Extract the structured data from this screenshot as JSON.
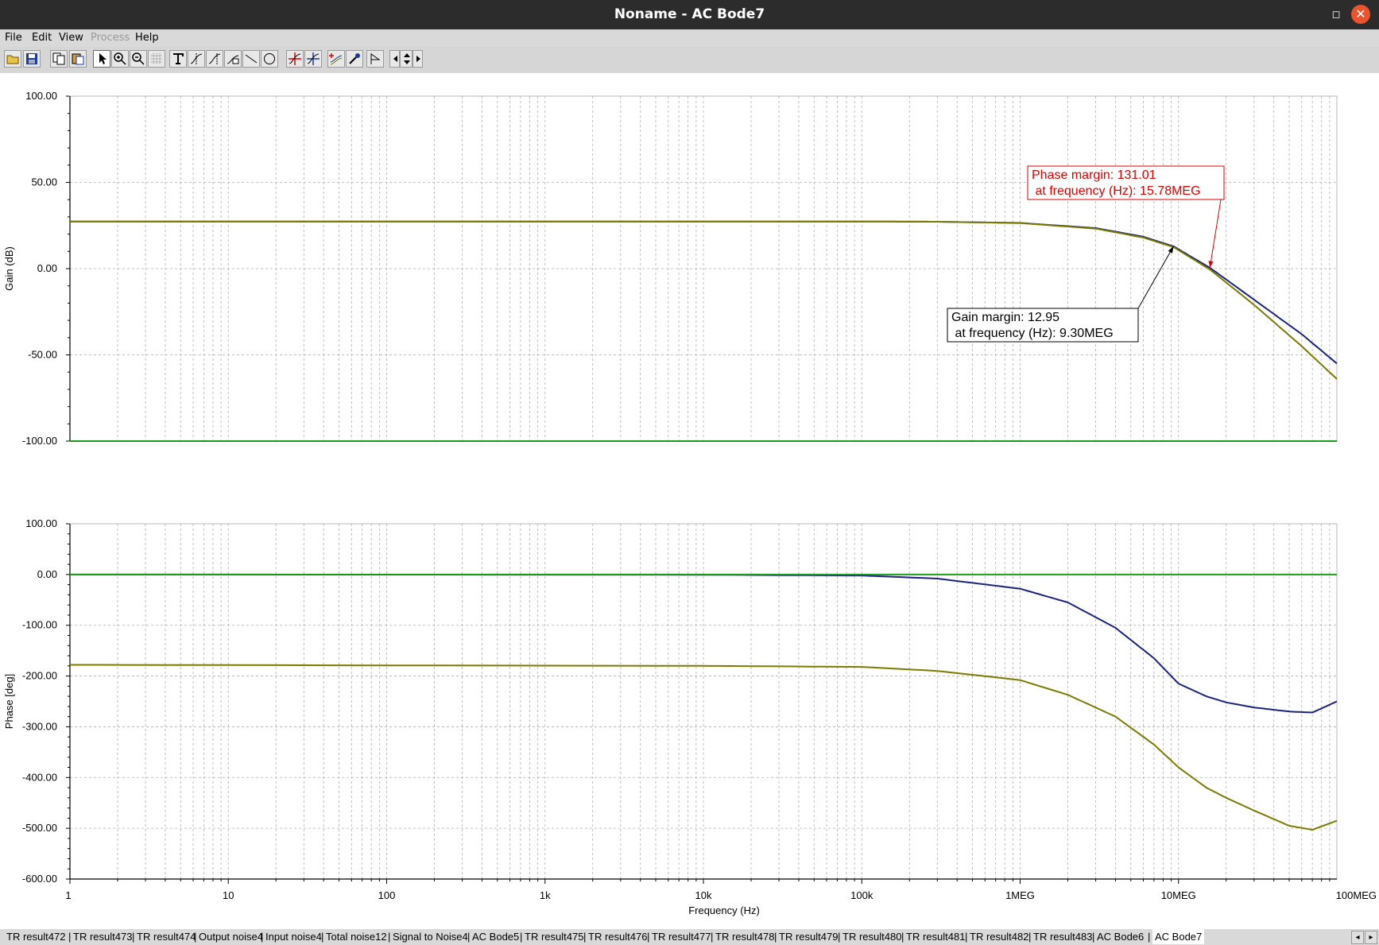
{
  "window": {
    "title": "Noname - AC Bode7",
    "maximize_glyph": "◻",
    "close_glyph": "✕"
  },
  "menu": [
    {
      "label": "File",
      "enabled": true
    },
    {
      "label": "Edit",
      "enabled": true
    },
    {
      "label": "View",
      "enabled": true
    },
    {
      "label": "Process",
      "enabled": false
    },
    {
      "label": "Help",
      "enabled": true
    }
  ],
  "toolbar": [
    {
      "icon": "open-folder-icon"
    },
    {
      "icon": "save-icon"
    },
    {
      "icon": "copy-icon"
    },
    {
      "icon": "paste-icon"
    },
    {
      "icon": "select-arrow-icon",
      "pressed": true
    },
    {
      "icon": "zoom-in-icon"
    },
    {
      "icon": "zoom-out-icon"
    },
    {
      "icon": "grid-icon"
    },
    {
      "icon": "text-tool-icon"
    },
    {
      "icon": "cursor-a-icon"
    },
    {
      "icon": "cursor-b-icon"
    },
    {
      "icon": "curve-label-icon"
    },
    {
      "icon": "line-tool-icon"
    },
    {
      "icon": "circle-tool-icon"
    },
    {
      "icon": "cursor-a-red-icon"
    },
    {
      "icon": "cursor-b-blue-icon"
    },
    {
      "icon": "add-curve-icon"
    },
    {
      "icon": "probe-icon"
    },
    {
      "icon": "arrow-tool-icon"
    },
    {
      "icon": "scroll-left-icon"
    },
    {
      "icon": "scroll-up-down-icon"
    },
    {
      "icon": "scroll-right-icon"
    }
  ],
  "colors": {
    "blue": "#1a237e",
    "olive": "#7b7b00",
    "green": "#1e9a1e",
    "red": "#e00000",
    "grid": "#b0b0b0"
  },
  "chart_data": [
    {
      "type": "line",
      "ylabel": "Gain (dB)",
      "xlabel": "",
      "x_scale": "log",
      "xlim": [
        1,
        100000000
      ],
      "ylim": [
        -100,
        100
      ],
      "y_ticks": [
        "100.00",
        "50.00",
        "0.00",
        "-50.00",
        "-100.00"
      ],
      "grid": true,
      "series": [
        {
          "color": "blue",
          "x": [
            1,
            1000,
            100000,
            300000,
            1000000,
            3000000,
            6000000,
            9300000,
            15780000,
            30000000,
            60000000,
            100000000
          ],
          "y": [
            27.3,
            27.3,
            27.3,
            27.2,
            26.5,
            23.5,
            18.5,
            12.95,
            0.5,
            -18,
            -38,
            -55
          ]
        },
        {
          "color": "olive",
          "x": [
            1,
            1000,
            100000,
            300000,
            1000000,
            3000000,
            6000000,
            9300000,
            15780000,
            30000000,
            60000000,
            100000000
          ],
          "y": [
            27.3,
            27.3,
            27.3,
            27.2,
            26.4,
            23.2,
            18,
            12.5,
            -0.5,
            -21,
            -45,
            -64
          ]
        },
        {
          "color": "green",
          "x": [
            1,
            100000000
          ],
          "y": [
            -100,
            -100
          ]
        }
      ],
      "annotations": [
        {
          "id": "phase-margin",
          "color": "red",
          "lines": [
            "Phase margin: 131.01",
            " at frequency (Hz): 15.78MEG"
          ],
          "point": [
            15780000,
            0.5
          ]
        },
        {
          "id": "gain-margin",
          "color": "black",
          "lines": [
            "Gain margin: 12.95",
            " at frequency (Hz): 9.30MEG"
          ],
          "point": [
            9300000,
            12.95
          ]
        }
      ]
    },
    {
      "type": "line",
      "ylabel": "Phase [deg]",
      "xlabel": "Frequency (Hz)",
      "x_scale": "log",
      "xlim": [
        1,
        100000000
      ],
      "ylim": [
        -600,
        100
      ],
      "y_ticks": [
        "100.00",
        "0.00",
        "-100.00",
        "-200.00",
        "-300.00",
        "-400.00",
        "-500.00",
        "-600.00"
      ],
      "x_ticks": [
        "1",
        "10",
        "100",
        "1k",
        "10k",
        "100k",
        "1MEG",
        "10MEG",
        "100MEG"
      ],
      "grid": true,
      "series": [
        {
          "color": "blue",
          "x": [
            1,
            10000,
            100000,
            300000,
            1000000,
            2000000,
            4000000,
            7000000,
            10000000,
            15000000,
            20000000,
            30000000,
            50000000,
            70000000,
            100000000
          ],
          "y": [
            0,
            -0.5,
            -2,
            -8,
            -28,
            -55,
            -105,
            -165,
            -215,
            -240,
            -252,
            -262,
            -270,
            -272,
            -250
          ]
        },
        {
          "color": "olive",
          "x": [
            1,
            10000,
            100000,
            300000,
            1000000,
            2000000,
            4000000,
            7000000,
            10000000,
            15000000,
            20000000,
            30000000,
            50000000,
            70000000,
            100000000
          ],
          "y": [
            -178,
            -180,
            -182,
            -190,
            -208,
            -237,
            -280,
            -335,
            -380,
            -420,
            -440,
            -465,
            -495,
            -503,
            -485
          ]
        },
        {
          "color": "green",
          "x": [
            1,
            100000000
          ],
          "y": [
            0,
            0
          ]
        }
      ]
    }
  ],
  "tabs": [
    {
      "label": "TR result472"
    },
    {
      "label": "TR result473"
    },
    {
      "label": "TR result474"
    },
    {
      "label": "Output noise4"
    },
    {
      "label": "Input noise4"
    },
    {
      "label": "Total noise12"
    },
    {
      "label": "Signal to Noise4"
    },
    {
      "label": "AC Bode5"
    },
    {
      "label": "TR result475"
    },
    {
      "label": "TR result476"
    },
    {
      "label": "TR result477"
    },
    {
      "label": "TR result478"
    },
    {
      "label": "TR result479"
    },
    {
      "label": "TR result480"
    },
    {
      "label": "TR result481"
    },
    {
      "label": "TR result482"
    },
    {
      "label": "TR result483"
    },
    {
      "label": "AC Bode6"
    },
    {
      "label": "AC Bode7",
      "active": true
    }
  ],
  "tab_scroll": {
    "left_glyph": "◂",
    "right_glyph": "▸"
  }
}
